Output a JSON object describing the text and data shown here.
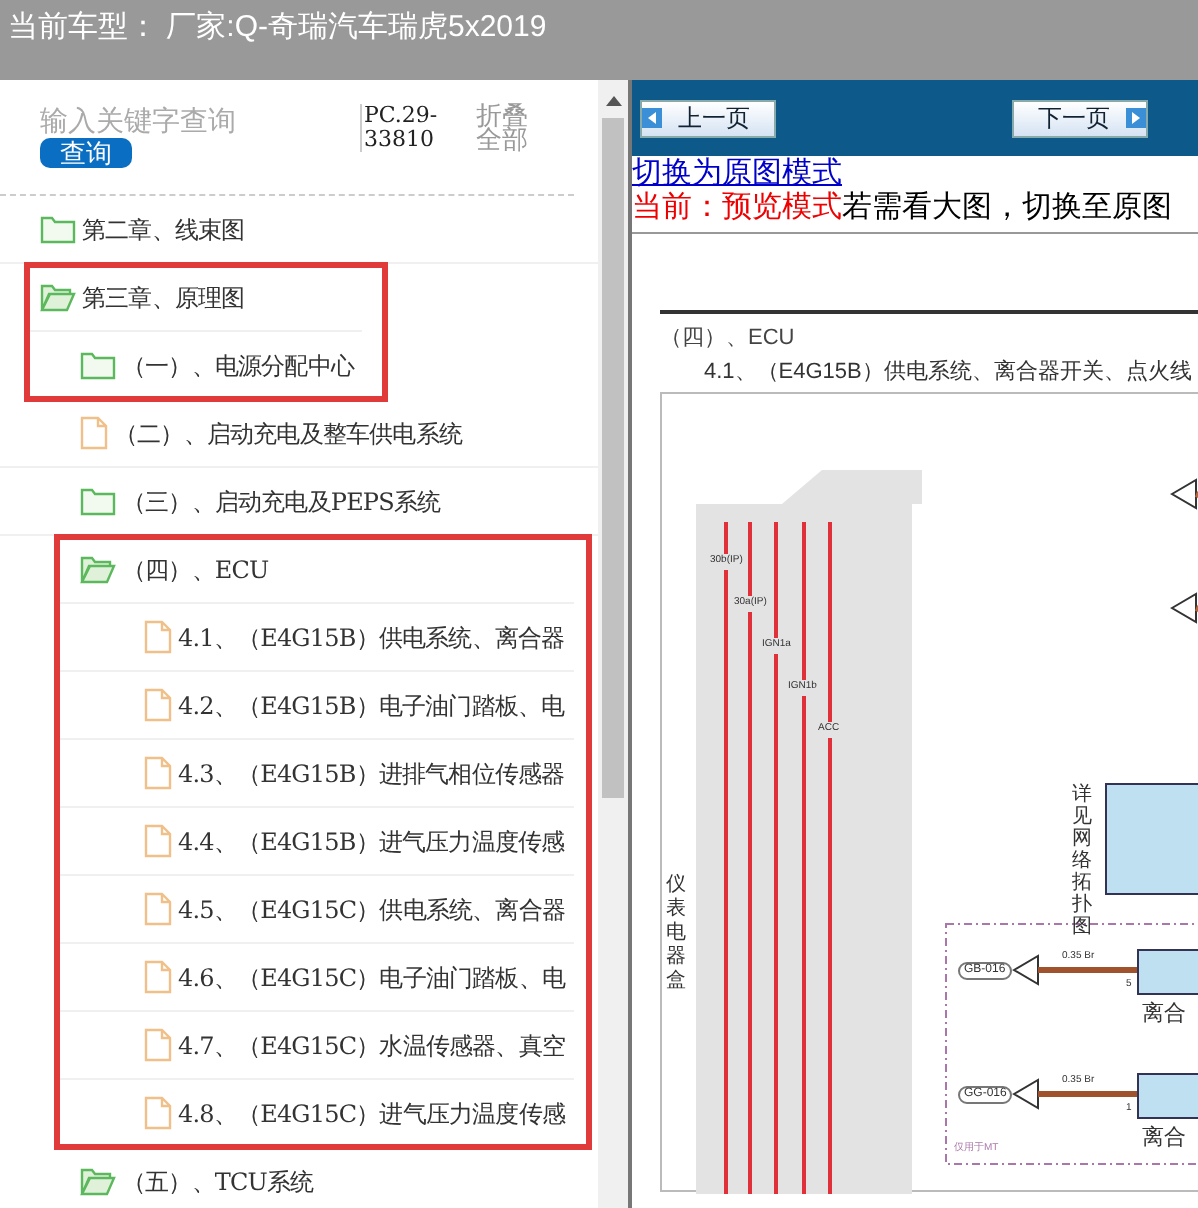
{
  "header": {
    "title": "当前车型：  厂家:Q-奇瑞汽车瑞虎5x2019"
  },
  "search": {
    "placeholder": "输入关键字查询",
    "button": "查询",
    "code": "PC.29-33810",
    "collapse": "折叠全部"
  },
  "tree": [
    {
      "kind": "folder",
      "label": "第二章、线束图",
      "expanded": false,
      "highlighted": false
    },
    {
      "kind": "folder",
      "label": "第三章、原理图",
      "expanded": true,
      "highlighted": true,
      "children": [
        {
          "kind": "folder",
          "label": "（一）、电源分配中心",
          "expanded": false,
          "highlighted": true
        },
        {
          "kind": "file",
          "label": "（二）、启动充电及整车供电系统",
          "highlighted": false
        },
        {
          "kind": "folder",
          "label": "（三）、启动充电及PEPS系统",
          "expanded": false,
          "highlighted": false
        },
        {
          "kind": "folder",
          "label": "（四）、ECU",
          "expanded": true,
          "highlighted": true,
          "children": [
            {
              "kind": "file",
              "label": "4.1、（E4G15B）供电系统、离合器",
              "highlighted": true
            },
            {
              "kind": "file",
              "label": "4.2、（E4G15B）电子油门踏板、电",
              "highlighted": true
            },
            {
              "kind": "file",
              "label": "4.3、（E4G15B）进排气相位传感器",
              "highlighted": true
            },
            {
              "kind": "file",
              "label": "4.4、（E4G15B）进气压力温度传感",
              "highlighted": true
            },
            {
              "kind": "file",
              "label": "4.5、（E4G15C）供电系统、离合器",
              "highlighted": true
            },
            {
              "kind": "file",
              "label": "4.6、（E4G15C）电子油门踏板、电",
              "highlighted": true
            },
            {
              "kind": "file",
              "label": "4.7、（E4G15C）水温传感器、真空",
              "highlighted": true
            },
            {
              "kind": "file",
              "label": "4.8、（E4G15C）进气压力温度传感",
              "highlighted": true
            }
          ]
        },
        {
          "kind": "folder",
          "label": "（五）、TCU系统",
          "expanded": true,
          "highlighted": false
        }
      ]
    }
  ],
  "viewer": {
    "prev": "上一页",
    "next": "下一页",
    "mode_link": "切换为原图模式",
    "mode_current": "当前：预览模式",
    "mode_hint": "若需看大图，切换至原图",
    "doc": {
      "section": "（四）、ECU",
      "heading": "4.1、（E4G15B）供电系统、离合器开关、点火线",
      "wires": [
        "30b(IP)",
        "30a(IP)",
        "IGN1a",
        "IGN1b",
        "ACC"
      ],
      "box_label": "仪表电器盒",
      "network_label": "详见网络拓扑图",
      "connectors": [
        {
          "tag": "GB-016",
          "wire": "0.35 Br",
          "pin": "5",
          "part": "离合"
        },
        {
          "tag": "GG-016",
          "wire": "0.35 Br",
          "pin": "1",
          "part": "离合"
        }
      ],
      "note": "仅用于MT"
    }
  }
}
